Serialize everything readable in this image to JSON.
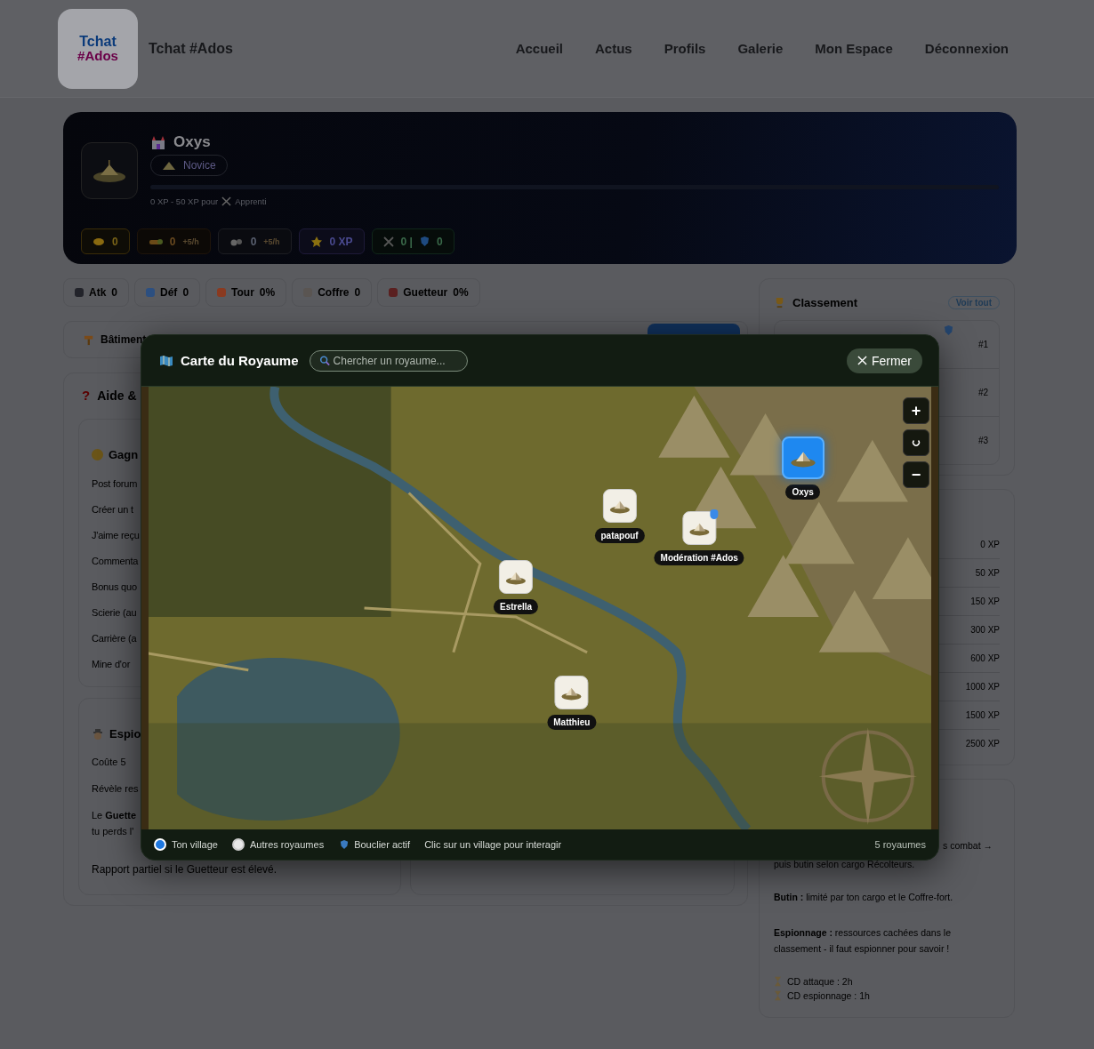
{
  "header": {
    "logo_text": [
      "Tchat",
      "#Ados"
    ],
    "site_name": "Tchat #Ados",
    "nav": [
      "Accueil",
      "Actus",
      "Profils",
      "Galerie",
      "Mon Espace",
      "Déconnexion"
    ]
  },
  "kingdom": {
    "name": "Oxys",
    "rank": "Novice",
    "level": 0,
    "progress_text": "0 XP - 50 XP pour",
    "next_rank": "Apprenti",
    "resources": [
      {
        "kind": "gold",
        "value": "0"
      },
      {
        "kind": "wood",
        "value": "0",
        "rate": "+5/h"
      },
      {
        "kind": "stone",
        "value": "0",
        "rate": "+5/h"
      },
      {
        "kind": "xp",
        "value": "0 XP"
      },
      {
        "kind": "army",
        "value": "0 |",
        "defense": "0"
      }
    ]
  },
  "stats": [
    {
      "kind": "atk",
      "label": "Atk",
      "value": "0"
    },
    {
      "kind": "def",
      "label": "Déf",
      "value": "0"
    },
    {
      "kind": "tower",
      "label": "Tour",
      "value": "0%"
    },
    {
      "kind": "vault",
      "label": "Coffre",
      "value": "0"
    },
    {
      "kind": "watch",
      "label": "Guetteur",
      "value": "0%"
    }
  ],
  "buildings": {
    "title": "Bâtiment"
  },
  "help": {
    "icon": "?",
    "title": "Aide &",
    "earn": {
      "title": "Gagn",
      "items": [
        "Post forum",
        "Créer un t",
        "J'aime reçu",
        "Commenta",
        "Bonus quo",
        "Scierie (au",
        "Carrière (a",
        "Mine d'or"
      ]
    },
    "spy": {
      "title": "Espio",
      "lines": [
        "Coûte 5",
        "Révèle res",
        "Le **Guette**",
        "tu perds l'"
      ],
      "note": "Rapport partiel si le Guetteur est élevé."
    }
  },
  "ranking": {
    "title": "Classement",
    "link": "Voir tout",
    "rows": [
      "#1",
      "#2",
      "#3"
    ]
  },
  "xp_levels": [
    "0 XP",
    "50 XP",
    "150 XP",
    "300 XP",
    "600 XP",
    "1000 XP",
    "1500 XP",
    "2500 XP"
  ],
  "rules": {
    "combat_tail": "s combat →",
    "combat_next": "puis butin selon cargo Récolteurs.",
    "loot": "**Butin :** limité par ton cargo et le Coffre-fort.",
    "spying": "**Espionnage :** ressources cachées dans le classement - il faut espionner pour savoir !",
    "cooldowns": [
      "CD attaque : 2h",
      "CD espionnage : 1h"
    ]
  },
  "map_modal": {
    "title": "Carte du Royaume",
    "search_placeholder": "Chercher un royaume...",
    "close": "Fermer",
    "zoom_in": "+",
    "zoom_out": "−",
    "villages": [
      {
        "name": "Oxys",
        "own": true,
        "shield": false
      },
      {
        "name": "patapouf",
        "own": false,
        "shield": false
      },
      {
        "name": "Modération #Ados",
        "own": false,
        "shield": true
      },
      {
        "name": "Estrella",
        "own": false,
        "shield": false
      },
      {
        "name": "Matthieu",
        "own": false,
        "shield": false
      }
    ],
    "legend": {
      "own": "Ton village",
      "others": "Autres royaumes",
      "shield": "Bouclier actif",
      "hint": "Clic sur un village pour interagir",
      "count": "5 royaumes"
    }
  }
}
